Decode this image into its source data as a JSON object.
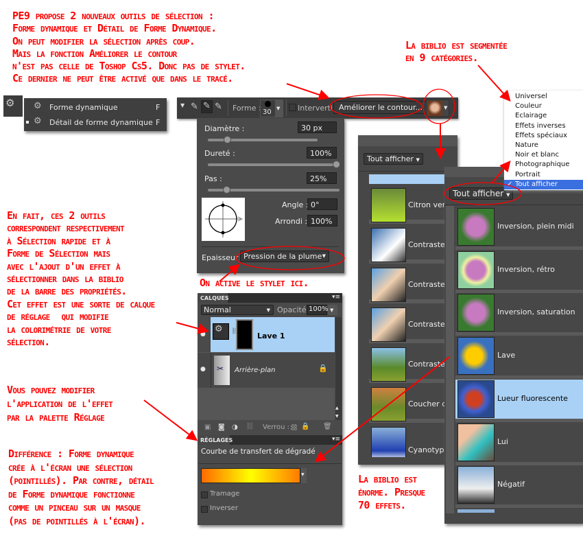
{
  "notes": {
    "intro": "PE9 propose 2 nouveaux outils de sélection :\nForme dynamique et Détail de Forme Dynamique.\nOn peut modifier la sélection après coup.\nMais la fonction Améliorer le contour\nn'est pas celle de Toshop Cs5. Donc pas de stylet.\nCe dernier ne peut être activé que dans le tracé.",
    "biblio_categories": "La biblio est segmentée\nen 9 catégories.",
    "en_fait": "En fait, ces 2 outils\ncorrespondent respectivement\nà Sélection rapide et à\nForme de Sélection mais\navec l'ajout d'un effet à\nsélectionner dans la biblio\nde la barre des propriétés.\nCet effet est une sorte de calque\nde réglage  qui modifie\nla colorimétrie de votre\nsélection.",
    "stylet": "On active le stylet ici.",
    "reglage": "Vous pouvez modifier\nl'application de l'effet\npar la palette Réglage",
    "difference": "Différence : Forme dynamique\ncrée à l'écran une sélection\n(pointillés). Par contre, détail\nde Forme dynamique fonctionne\ncomme un pinceau sur un masque\n(pas de pointillés à l'écran).",
    "biblio_enorme": "La biblio est\nénorme. Presque\n70 effets."
  },
  "tool_menu": {
    "items": [
      {
        "label": "Forme dynamique",
        "shortcut": "F",
        "selected": false
      },
      {
        "label": "Détail de forme dynamique",
        "shortcut": "F",
        "selected": true
      }
    ]
  },
  "toolbar": {
    "forme_label": "Forme :",
    "brush_size": "30",
    "intervertir_label": "Intervertir",
    "ameliorer_button": "Améliorer le contour..."
  },
  "brush_panel": {
    "diametre_label": "Diamètre :",
    "diametre_value": "30 px",
    "diametre_slider": 0.15,
    "durete_label": "Dureté :",
    "durete_value": "100%",
    "durete_slider": 1.0,
    "pas_label": "Pas :",
    "pas_value": "25%",
    "pas_slider": 0.12,
    "angle_label": "Angle :",
    "angle_value": "0°",
    "arrondi_label": "Arrondi :",
    "arrondi_value": "100%",
    "epaisseur_label": "Epaisseur :",
    "epaisseur_value": "Pression de la plume"
  },
  "layers_panel": {
    "title": "CALQUES",
    "blend_mode": "Normal",
    "opacity_label": "Opacité :",
    "opacity_value": "100%",
    "layers": [
      {
        "name": "Lave 1",
        "selected": true
      },
      {
        "name": "Arrière-plan",
        "selected": false,
        "locked": true
      }
    ],
    "verrou_label": "Verrou :"
  },
  "adjust_panel": {
    "title": "RÉGLAGES",
    "subtitle": "Courbe de transfert de dégradé",
    "gradient_colors": [
      "#ff6a00",
      "#ffff00",
      "#ff7a00"
    ],
    "tramage_label": "Tramage",
    "inverser_label": "Inverser"
  },
  "library_back": {
    "filter": "Tout afficher",
    "items": [
      "Citron vert",
      "Contraste a",
      "Contraste c",
      "Contraste f",
      "Contraste r",
      "Coucher de",
      "Cyanotype"
    ]
  },
  "library_front": {
    "filter": "Tout afficher",
    "items": [
      {
        "label": "Inversion, plein midi",
        "selected": false
      },
      {
        "label": "Inversion, rétro",
        "selected": false
      },
      {
        "label": "Inversion, saturation",
        "selected": false
      },
      {
        "label": "Lave",
        "selected": false
      },
      {
        "label": "Lueur fluorescente",
        "selected": true
      },
      {
        "label": "Lui",
        "selected": false
      },
      {
        "label": "Négatif",
        "selected": false
      }
    ]
  },
  "category_menu": {
    "items": [
      "Universel",
      "Couleur",
      "Eclairage",
      "Effets inverses",
      "Effets spéciaux",
      "Nature",
      "Noir et blanc",
      "Photographique",
      "Portrait",
      "Tout afficher"
    ],
    "checked": "Tout afficher"
  },
  "colors": {
    "annotation": "#ff0000",
    "panel": "#474747",
    "selection": "#a9d1f5",
    "menu_highlight": "#3a6fe0"
  }
}
